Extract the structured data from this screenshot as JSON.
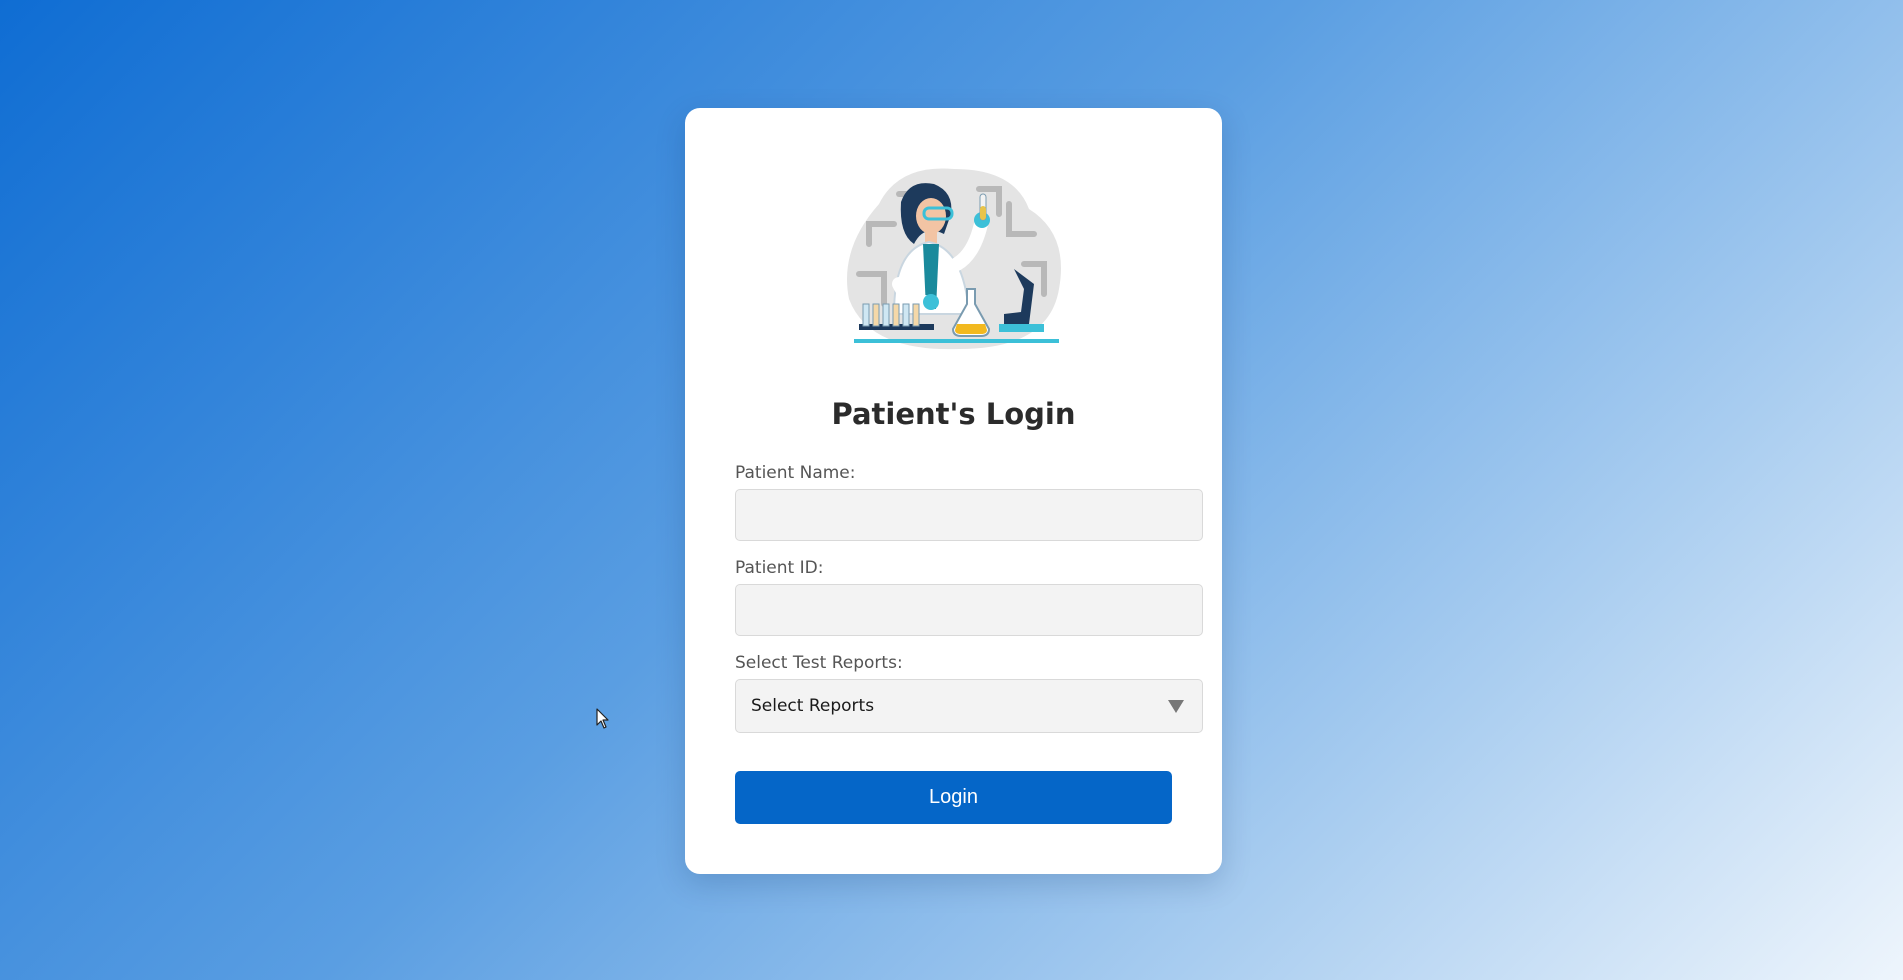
{
  "form": {
    "title": "Patient's Login",
    "patient_name_label": "Patient Name:",
    "patient_name_value": "",
    "patient_id_label": "Patient ID:",
    "patient_id_value": "",
    "reports_label": "Select Test Reports:",
    "reports_selected": "Select Reports",
    "login_label": "Login"
  },
  "icons": {
    "illustration": "scientist-illustration",
    "dropdown": "chevron-down-icon",
    "cursor": "mouse-pointer"
  },
  "colors": {
    "accent": "#0566c8",
    "card": "#ffffff",
    "field_bg": "#f3f3f3",
    "gradient_start": "#0f6dd3",
    "gradient_end": "#eef5fc"
  }
}
